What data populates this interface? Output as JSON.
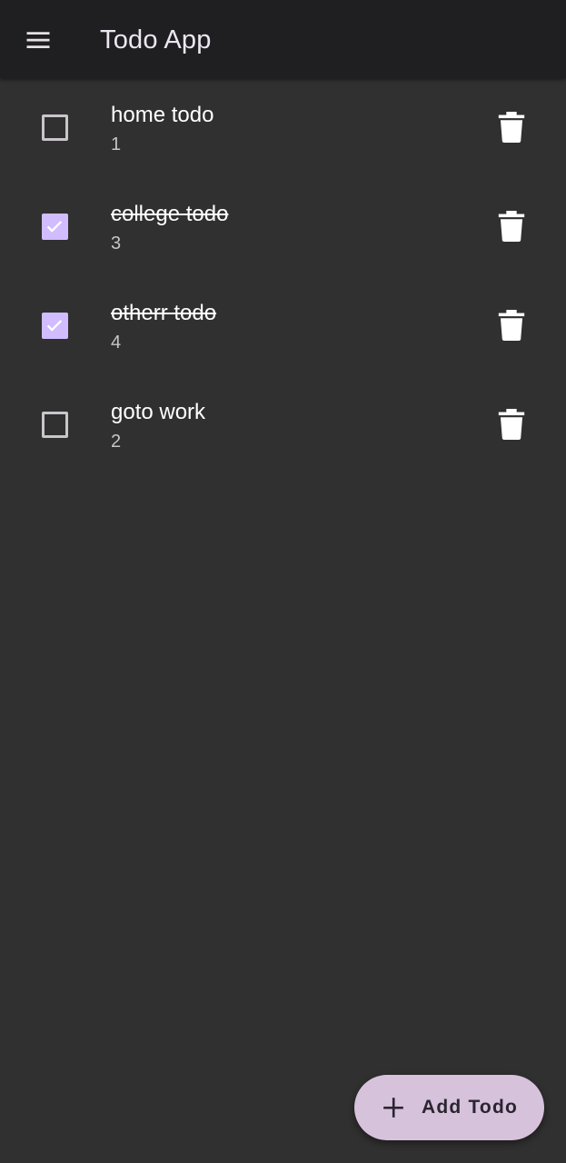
{
  "appbar": {
    "title": "Todo App",
    "menu_icon": "menu-icon"
  },
  "todos": [
    {
      "title": "home todo",
      "subtitle": "1",
      "done": false
    },
    {
      "title": "college todo",
      "subtitle": "3",
      "done": true
    },
    {
      "title": "otherr todo",
      "subtitle": "4",
      "done": true
    },
    {
      "title": "goto work",
      "subtitle": "2",
      "done": false
    }
  ],
  "fab": {
    "label": "Add Todo",
    "icon": "plus-icon"
  },
  "colors": {
    "background": "#303030",
    "appbar": "#1f1e20",
    "accent": "#d0bcff",
    "fab": "#d7c2dc"
  }
}
